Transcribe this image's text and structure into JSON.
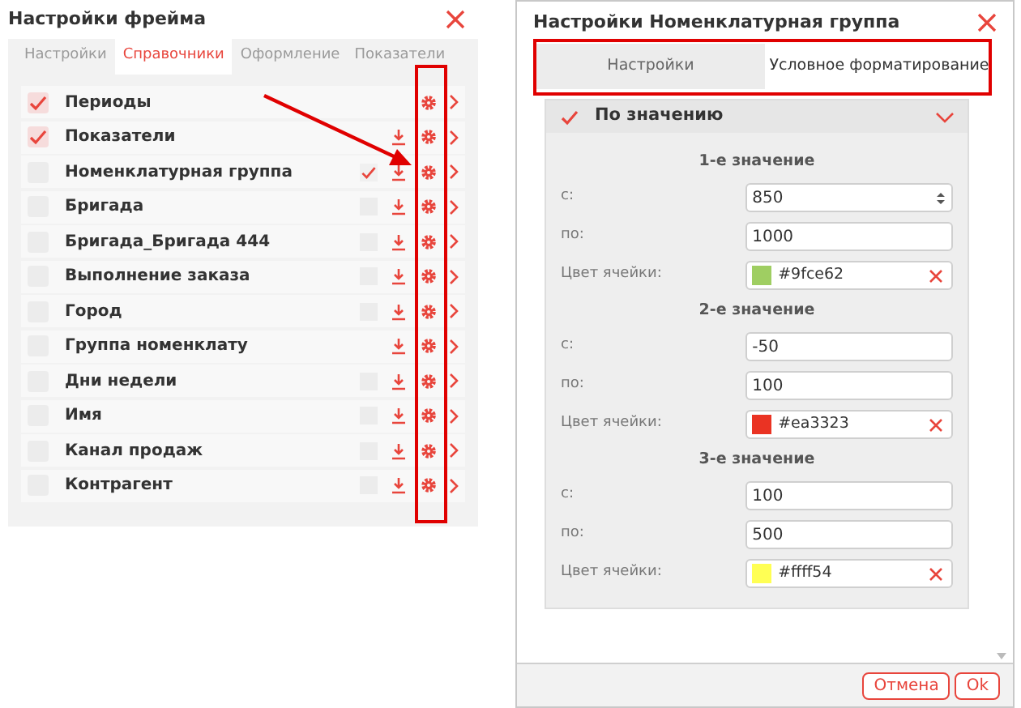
{
  "frame_settings": {
    "title": "Настройки фрейма",
    "tabs": [
      {
        "label": "Настройки",
        "selected": false
      },
      {
        "label": "Справочники",
        "selected": true
      },
      {
        "label": "Оформление",
        "selected": false
      },
      {
        "label": "Показатели",
        "selected": false
      }
    ],
    "rows": [
      {
        "name": "Периоды",
        "checked": true,
        "download": false
      },
      {
        "name": "Показатели",
        "checked": true,
        "download": true
      },
      {
        "name": "Номенклатурная группа",
        "checked": false,
        "right_checked": true,
        "download": true
      },
      {
        "name": "Бригада",
        "checked": false,
        "right_checked": false,
        "download": true
      },
      {
        "name": "Бригада_Бригада 444",
        "checked": false,
        "right_checked": false,
        "download": true
      },
      {
        "name": "Выполнение заказа",
        "checked": false,
        "right_checked": false,
        "download": true
      },
      {
        "name": "Город",
        "checked": false,
        "right_checked": false,
        "download": true
      },
      {
        "name": "Группа номенклату",
        "checked": false,
        "download": true
      },
      {
        "name": "Дни недели",
        "checked": false,
        "right_checked": false,
        "download": true
      },
      {
        "name": "Имя",
        "checked": false,
        "right_checked": false,
        "download": true
      },
      {
        "name": "Канал продаж",
        "checked": false,
        "right_checked": false,
        "download": true
      },
      {
        "name": "Контрагент",
        "checked": false,
        "right_checked": false,
        "download": true
      }
    ]
  },
  "group_settings": {
    "title": "Настройки Номенклатурная группа",
    "tabs": [
      {
        "label": "Настройки",
        "selected": false
      },
      {
        "label": "Условное форматирование",
        "selected": true
      }
    ],
    "section": {
      "title": "По значению",
      "checked": true,
      "expanded": true,
      "values": [
        {
          "title": "1-е значение",
          "from_label": "с:",
          "from": "850",
          "to_label": "по:",
          "to": "1000",
          "color_label": "Цвет ячейки:",
          "color": "#9fce62",
          "color_text": "#9fce62"
        },
        {
          "title": "2-е значение",
          "from_label": "с:",
          "from": "-50",
          "to_label": "по:",
          "to": "100",
          "color_label": "Цвет ячейки:",
          "color": "#ea3323",
          "color_text": "#ea3323"
        },
        {
          "title": "3-е значение",
          "from_label": "с:",
          "from": "100",
          "to_label": "по:",
          "to": "500",
          "color_label": "Цвет ячейки:",
          "color": "#ffff54",
          "color_text": "#ffff54"
        }
      ]
    },
    "buttons": [
      "Отмена",
      "Ok"
    ]
  }
}
